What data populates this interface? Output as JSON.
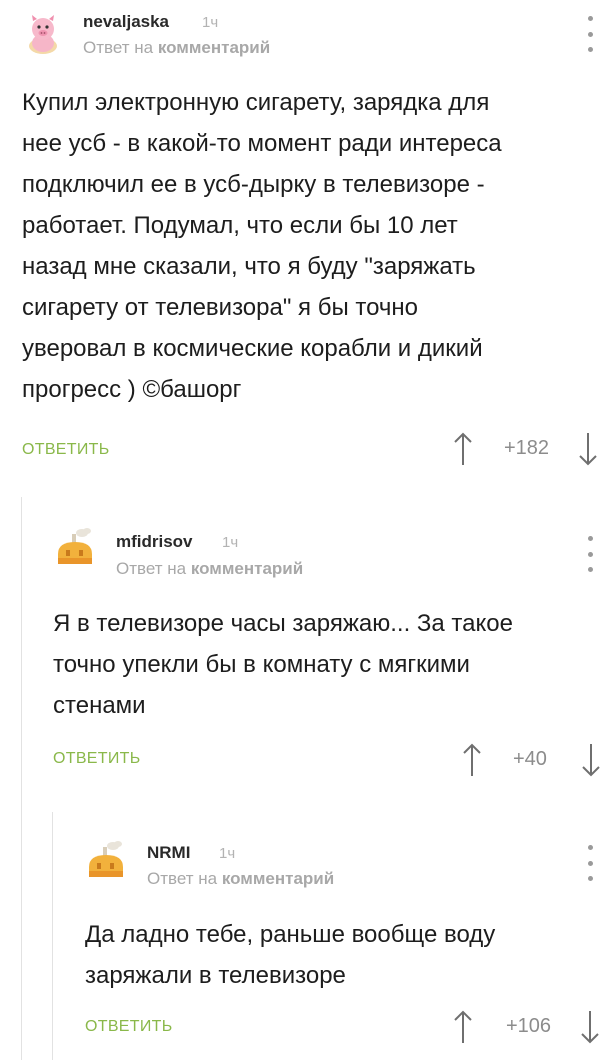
{
  "comments": [
    {
      "author": "nevaljaska",
      "time": "1ч",
      "reply_prefix": "Ответ на",
      "reply_target": "комментарий",
      "text": "Купил электронную сигарету, зарядка для\nнее усб - в какой-то момент ради интереса\nподключил ее в усб-дырку в телевизоре -\nработает. Подумал, что если бы 10 лет\nназад мне сказали, что я буду \"заряжать\nсигарету от телевизора\" я бы точно\nуверовал в космические корабли и дикий\nпрогресс ) ©башорг",
      "reply_label": "ОТВЕТИТЬ",
      "rating": "+182",
      "avatar_icon": "pig-toy-icon"
    },
    {
      "author": "mfidrisov",
      "time": "1ч",
      "reply_prefix": "Ответ на",
      "reply_target": "комментарий",
      "text": "Я в телевизоре часы заряжаю... За такое\nточно упекли бы в комнату с мягкими\nстенами",
      "reply_label": "ОТВЕТИТЬ",
      "rating": "+40",
      "avatar_icon": "cake-avatar-icon"
    },
    {
      "author": "NRMI",
      "time": "1ч",
      "reply_prefix": "Ответ на",
      "reply_target": "комментарий",
      "text": "Да ладно тебе, раньше вообще воду\nзаряжали в телевизоре",
      "reply_label": "ОТВЕТИТЬ",
      "rating": "+106",
      "avatar_icon": "cake-avatar-icon"
    }
  ],
  "colors": {
    "accent_green": "#8ab84a",
    "meta_gray": "#a8a8a8",
    "thread_line": "#e2e2e2"
  }
}
